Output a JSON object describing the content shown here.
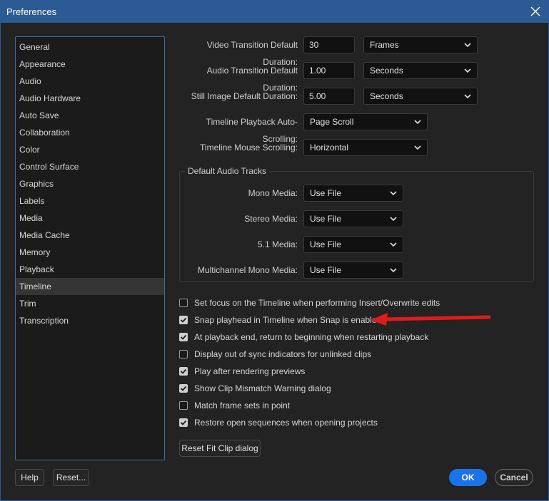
{
  "window": {
    "title": "Preferences"
  },
  "sidebar": {
    "items": [
      {
        "label": "General"
      },
      {
        "label": "Appearance"
      },
      {
        "label": "Audio"
      },
      {
        "label": "Audio Hardware"
      },
      {
        "label": "Auto Save"
      },
      {
        "label": "Collaboration"
      },
      {
        "label": "Color"
      },
      {
        "label": "Control Surface"
      },
      {
        "label": "Graphics"
      },
      {
        "label": "Labels"
      },
      {
        "label": "Media"
      },
      {
        "label": "Media Cache"
      },
      {
        "label": "Memory"
      },
      {
        "label": "Playback"
      },
      {
        "label": "Timeline",
        "selected": true
      },
      {
        "label": "Trim"
      },
      {
        "label": "Transcription"
      }
    ]
  },
  "durations": {
    "video": {
      "label": "Video Transition Default Duration:",
      "value": "30",
      "unit": "Frames"
    },
    "audio": {
      "label": "Audio Transition Default Duration:",
      "value": "1.00",
      "unit": "Seconds"
    },
    "still": {
      "label": "Still Image Default Duration:",
      "value": "5.00",
      "unit": "Seconds"
    }
  },
  "playback_scroll": {
    "label": "Timeline Playback Auto-Scrolling:",
    "value": "Page Scroll"
  },
  "mouse_scroll": {
    "label": "Timeline Mouse Scrolling:",
    "value": "Horizontal"
  },
  "audio_tracks": {
    "legend": "Default Audio Tracks",
    "mono": {
      "label": "Mono Media:",
      "value": "Use File"
    },
    "stereo": {
      "label": "Stereo Media:",
      "value": "Use File"
    },
    "five_one": {
      "label": "5.1 Media:",
      "value": "Use File"
    },
    "multichannel": {
      "label": "Multichannel Mono Media:",
      "value": "Use File"
    }
  },
  "checkboxes": [
    {
      "label": "Set focus on the Timeline when performing Insert/Overwrite edits",
      "checked": false
    },
    {
      "label": "Snap playhead in Timeline when Snap is enabled",
      "checked": true
    },
    {
      "label": "At playback end, return to beginning when restarting playback",
      "checked": true
    },
    {
      "label": "Display out of sync indicators for unlinked clips",
      "checked": false
    },
    {
      "label": "Play after rendering previews",
      "checked": true
    },
    {
      "label": "Show Clip Mismatch Warning dialog",
      "checked": true
    },
    {
      "label": "Match frame sets in point",
      "checked": false
    },
    {
      "label": "Restore open sequences when opening projects",
      "checked": true
    }
  ],
  "buttons": {
    "reset_fit": "Reset Fit Clip dialog",
    "help": "Help",
    "reset": "Reset...",
    "ok": "OK",
    "cancel": "Cancel"
  },
  "colors": {
    "titlebar": "#2c5a94",
    "accent": "#1a73e8",
    "annotation_arrow": "#e01b1b"
  }
}
